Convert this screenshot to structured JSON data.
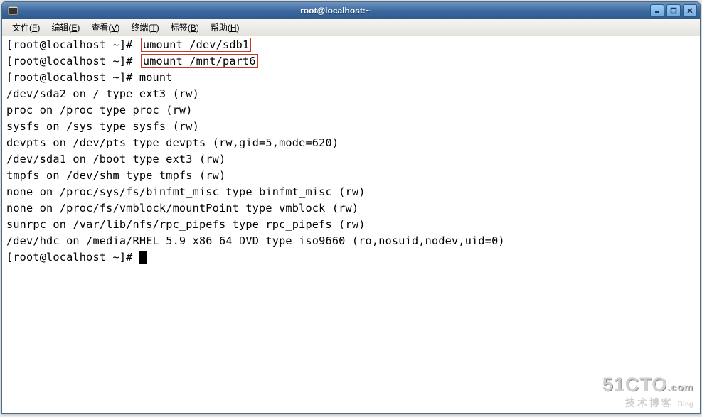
{
  "window": {
    "title": "root@localhost:~"
  },
  "menus": {
    "file": "文件",
    "file_u": "F",
    "edit": "编辑",
    "edit_u": "E",
    "view": "查看",
    "view_u": "V",
    "terminal": "终端",
    "terminal_u": "T",
    "tabs": "标签",
    "tabs_u": "B",
    "help": "帮助",
    "help_u": "H"
  },
  "prompt": "[root@localhost ~]# ",
  "cmd1": "umount /dev/sdb1",
  "cmd2": "umount /mnt/part6",
  "cmd3": "mount",
  "out": [
    "/dev/sda2 on / type ext3 (rw)",
    "proc on /proc type proc (rw)",
    "sysfs on /sys type sysfs (rw)",
    "devpts on /dev/pts type devpts (rw,gid=5,mode=620)",
    "/dev/sda1 on /boot type ext3 (rw)",
    "tmpfs on /dev/shm type tmpfs (rw)",
    "none on /proc/sys/fs/binfmt_misc type binfmt_misc (rw)",
    "none on /proc/fs/vmblock/mountPoint type vmblock (rw)",
    "sunrpc on /var/lib/nfs/rpc_pipefs type rpc_pipefs (rw)",
    "/dev/hdc on /media/RHEL_5.9 x86_64 DVD type iso9660 (ro,nosuid,nodev,uid=0)"
  ],
  "watermark": {
    "line1": "51CTO",
    "suffix": ".com",
    "line2": "技术博客",
    "blog": "Blog"
  }
}
